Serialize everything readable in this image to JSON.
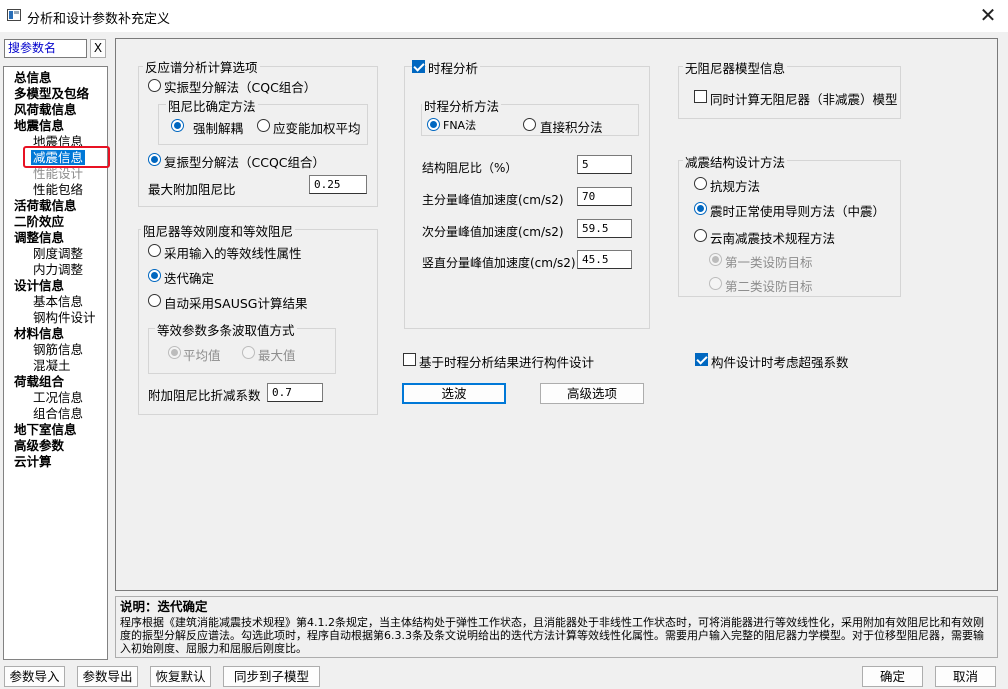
{
  "window": {
    "title": "分析和设计参数补充定义",
    "close_label": "X"
  },
  "search": {
    "value": "搜参数名",
    "clear_label": "X"
  },
  "nav": [
    {
      "label": "总信息",
      "level": 0
    },
    {
      "label": "多模型及包络",
      "level": 0
    },
    {
      "label": "风荷载信息",
      "level": 0
    },
    {
      "label": "地震信息",
      "level": 0
    },
    {
      "label": "地震信息",
      "level": 1
    },
    {
      "label": "减震信息",
      "level": 1,
      "selected": true
    },
    {
      "label": "性能设计",
      "level": 1,
      "disabled": true
    },
    {
      "label": "性能包络",
      "level": 1
    },
    {
      "label": "活荷载信息",
      "level": 0
    },
    {
      "label": "二阶效应",
      "level": 0
    },
    {
      "label": "调整信息",
      "level": 0
    },
    {
      "label": "刚度调整",
      "level": 1
    },
    {
      "label": "内力调整",
      "level": 1
    },
    {
      "label": "设计信息",
      "level": 0
    },
    {
      "label": "基本信息",
      "level": 1
    },
    {
      "label": "钢构件设计",
      "level": 1
    },
    {
      "label": "材料信息",
      "level": 0
    },
    {
      "label": "钢筋信息",
      "level": 1
    },
    {
      "label": "混凝土",
      "level": 1
    },
    {
      "label": "荷载组合",
      "level": 0
    },
    {
      "label": "工况信息",
      "level": 1
    },
    {
      "label": "组合信息",
      "level": 1
    },
    {
      "label": "地下室信息",
      "level": 0
    },
    {
      "label": "高级参数",
      "level": 0
    },
    {
      "label": "云计算",
      "level": 0
    }
  ],
  "spectrum": {
    "title": "反应谱分析计算选项",
    "real_mode": "实振型分解法（CQC组合）",
    "damping_method_title": "阻尼比确定方法",
    "forced_decouple": "强制解耦",
    "strain_energy": "应变能加权平均",
    "complex_mode": "复振型分解法（CCQC组合）",
    "max_damping_label": "最大附加阻尼比",
    "max_damping_value": "0.25"
  },
  "equiv": {
    "title": "阻尼器等效刚度和等效阻尼",
    "use_input": "采用输入的等效线性属性",
    "iterative": "迭代确定",
    "sausg": "自动采用SAUSG计算结果",
    "multi_wave_title": "等效参数多条波取值方式",
    "average": "平均值",
    "maximum": "最大值",
    "reduction_label": "附加阻尼比折减系数",
    "reduction_value": "0.7"
  },
  "timehistory": {
    "enable_label": "时程分析",
    "method_title": "时程分析方法",
    "fna": "FNA法",
    "direct": "直接积分法",
    "damping_label": "结构阻尼比（%）",
    "damping_value": "5",
    "main_accel_label": "主分量峰值加速度(cm/s2)",
    "main_accel_value": "70",
    "sub_accel_label": "次分量峰值加速度(cm/s2)",
    "sub_accel_value": "59.5",
    "vert_accel_label": "竖直分量峰值加速度(cm/s2)",
    "vert_accel_value": "45.5"
  },
  "no_damper": {
    "title": "无阻尼器模型信息",
    "simultaneous": "同时计算无阻尼器（非减震）模型"
  },
  "design_method": {
    "title": "减震结构设计方法",
    "code": "抗规方法",
    "guide": "震时正常使用导则方法（中震）",
    "yunnan": "云南减震技术规程方法",
    "first_target": "第一类设防目标",
    "second_target": "第二类设防目标"
  },
  "bottom": {
    "th_design": "基于时程分析结果进行构件设计",
    "over_strength": "构件设计时考虑超强系数",
    "select_wave": "选波",
    "advanced": "高级选项"
  },
  "description": {
    "title": "说明：迭代确定",
    "text": "程序根据《建筑消能减震技术规程》第4.1.2条规定，当主体结构处于弹性工作状态，且消能器处于非线性工作状态时，可将消能器进行等效线性化，采用附加有效阻尼比和有效刚度的振型分解反应谱法。勾选此项时，程序自动根据第6.3.3条及条文说明给出的迭代方法计算等效线性化属性。需要用户输入完整的阻尼器力学模型。对于位移型阻尼器，需要输入初始刚度、屈服力和屈服后刚度比。"
  },
  "footer": {
    "import": "参数导入",
    "export": "参数导出",
    "restore": "恢复默认",
    "sync": "同步到子模型",
    "ok": "确定",
    "cancel": "取消"
  }
}
